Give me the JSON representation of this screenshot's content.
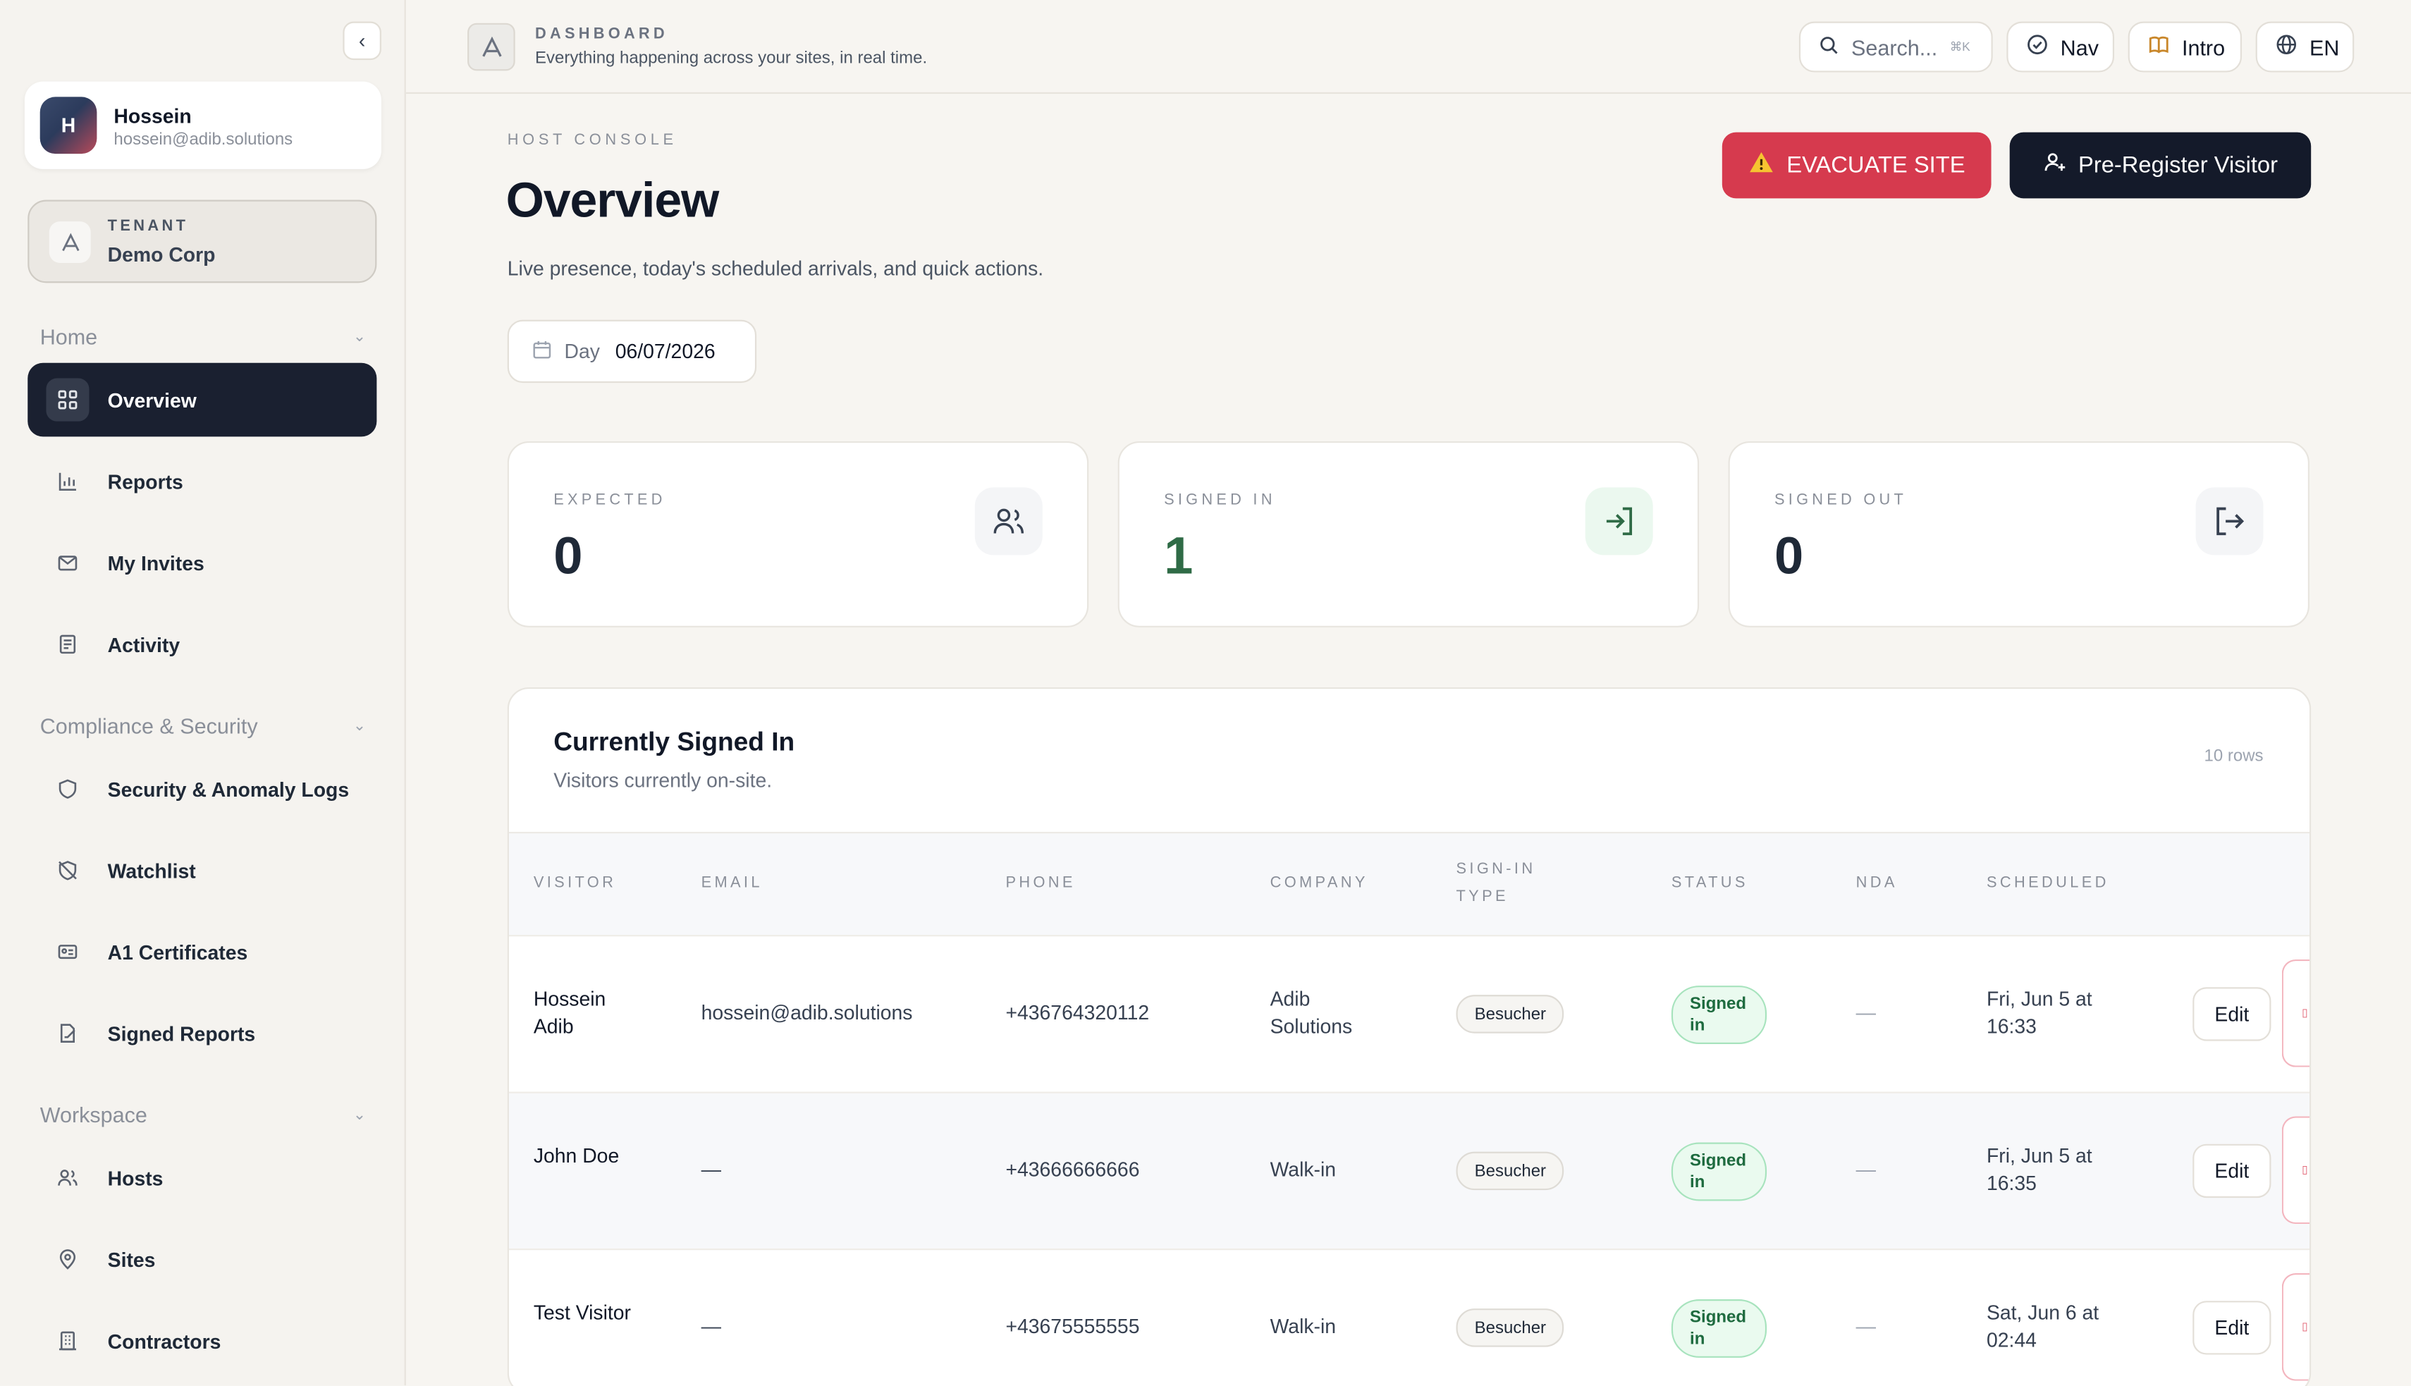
{
  "sidebar": {
    "user": {
      "initial": "H",
      "name": "Hossein",
      "email": "hossein@adib.solutions"
    },
    "tenant": {
      "label": "TENANT",
      "name": "Demo Corp"
    },
    "sections": [
      {
        "title": "Home",
        "items": [
          {
            "label": "Overview",
            "icon": "grid-icon",
            "active": true
          },
          {
            "label": "Reports",
            "icon": "chart-icon"
          },
          {
            "label": "My Invites",
            "icon": "mail-icon"
          },
          {
            "label": "Activity",
            "icon": "activity-icon"
          }
        ]
      },
      {
        "title": "Compliance & Security",
        "items": [
          {
            "label": "Security & Anomaly Logs",
            "icon": "shield-icon"
          },
          {
            "label": "Watchlist",
            "icon": "shield-off-icon"
          },
          {
            "label": "A1 Certificates",
            "icon": "id-card-icon"
          },
          {
            "label": "Signed Reports",
            "icon": "file-signed-icon"
          }
        ]
      },
      {
        "title": "Workspace",
        "items": [
          {
            "label": "Hosts",
            "icon": "users-icon"
          },
          {
            "label": "Sites",
            "icon": "map-pin-icon"
          },
          {
            "label": "Contractors",
            "icon": "building-icon"
          }
        ]
      }
    ]
  },
  "topbar": {
    "title": "DASHBOARD",
    "subtitle": "Everything happening across your sites, in real time.",
    "search_placeholder": "Search...",
    "search_shortcut": "⌘K",
    "nav_label": "Nav",
    "intro_label": "Intro",
    "lang_label": "EN"
  },
  "main": {
    "eyebrow": "HOST CONSOLE",
    "title": "Overview",
    "description": "Live presence, today's scheduled arrivals, and quick actions.",
    "evacuate_label": "EVACUATE SITE",
    "preregister_label": "Pre-Register Visitor",
    "day_label": "Day",
    "day_value": "06/07/2026"
  },
  "stats": [
    {
      "label": "EXPECTED",
      "value": "0",
      "icon": "users-icon"
    },
    {
      "label": "SIGNED IN",
      "value": "1",
      "icon": "sign-in-icon"
    },
    {
      "label": "SIGNED OUT",
      "value": "0",
      "icon": "sign-out-icon"
    }
  ],
  "table": {
    "title": "Currently Signed In",
    "subtitle": "Visitors currently on-site.",
    "row_count": "10 rows",
    "columns": [
      "VISITOR",
      "EMAIL",
      "PHONE",
      "COMPANY",
      "SIGN-IN TYPE",
      "STATUS",
      "NDA",
      "SCHEDULED"
    ],
    "rows": [
      {
        "visitor": "Hossein Adib",
        "email": "hossein@adib.solutions",
        "phone": "+436764320112",
        "company": "Adib Solutions",
        "type": "Besucher",
        "status": "Signed in",
        "nda": "—",
        "scheduled": "Fri, Jun 5 at 16:33",
        "edit": "Edit"
      },
      {
        "visitor": "John Doe",
        "email": "—",
        "phone": "+43666666666",
        "company": "Walk-in",
        "type": "Besucher",
        "status": "Signed in",
        "nda": "—",
        "scheduled": "Fri, Jun 5 at 16:35",
        "edit": "Edit"
      },
      {
        "visitor": "Test Visitor",
        "email": "—",
        "phone": "+43675555555",
        "company": "Walk-in",
        "type": "Besucher",
        "status": "Signed in",
        "nda": "—",
        "scheduled": "Sat, Jun 6 at 02:44",
        "edit": "Edit"
      }
    ]
  },
  "colors": {
    "danger": "#d63a4e",
    "primary_dark": "#141a2a",
    "success": "#1e6b3f",
    "background": "#f7f5f1"
  }
}
